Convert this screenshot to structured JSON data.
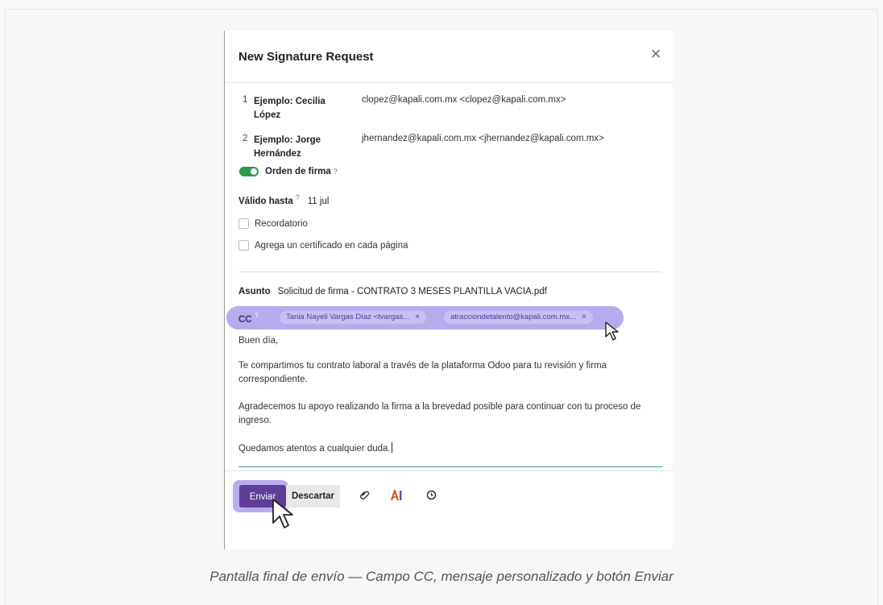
{
  "dialog": {
    "title": "New Signature Request",
    "close_icon": "close-icon"
  },
  "signers": [
    {
      "index": "1",
      "name": "Ejemplo: Cecilia López",
      "email": "clopez@kapali.com.mx <clopez@kapali.com.mx>"
    },
    {
      "index": "2",
      "name": "Ejemplo: Jorge Hernández",
      "email": "jhernandez@kapali.com.mx <jhernandez@kapali.com.mx>"
    }
  ],
  "options": {
    "order_label": "Orden de firma",
    "order_enabled": true,
    "valid_label": "Válido hasta",
    "valid_value": "11 jul",
    "reminder_label": "Recordatorio",
    "certificate_label": "Agrega un certificado en cada página",
    "help_mark": "?"
  },
  "mail": {
    "subject_label": "Asunto",
    "subject_value": "Solicitud de firma - CONTRATO 3 MESES PLANTILLA VACIA.pdf",
    "cc_label": "CC",
    "cc_chips": [
      "Tania Nayeli Vargas Díaz <tvargas...",
      "atracciondetalento@kapali.com.mx..."
    ],
    "chip_remove": "×",
    "body": [
      "Buen día,",
      "Te compartimos tu contrato laboral a través de la plataforma Odoo para tu revisión y firma correspondiente.",
      "Agradecemos tu apoyo realizando la firma a la brevedad posible para continuar con tu proceso de ingreso.",
      "Quedamos atentos a cualquier duda."
    ]
  },
  "footer": {
    "send_label": "Enviar",
    "discard_label": "Descartar",
    "icons": [
      "paperclip-icon",
      "ai-icon",
      "clock-icon"
    ]
  },
  "caption": "Pantalla final de envío — Campo CC, mensaje personalizado y botón Enviar",
  "colors": {
    "accent_purple": "#5f3e98",
    "highlight": "#b9acef",
    "toggle_green": "#2c9a4a",
    "help_blue": "#2a8ba6"
  }
}
